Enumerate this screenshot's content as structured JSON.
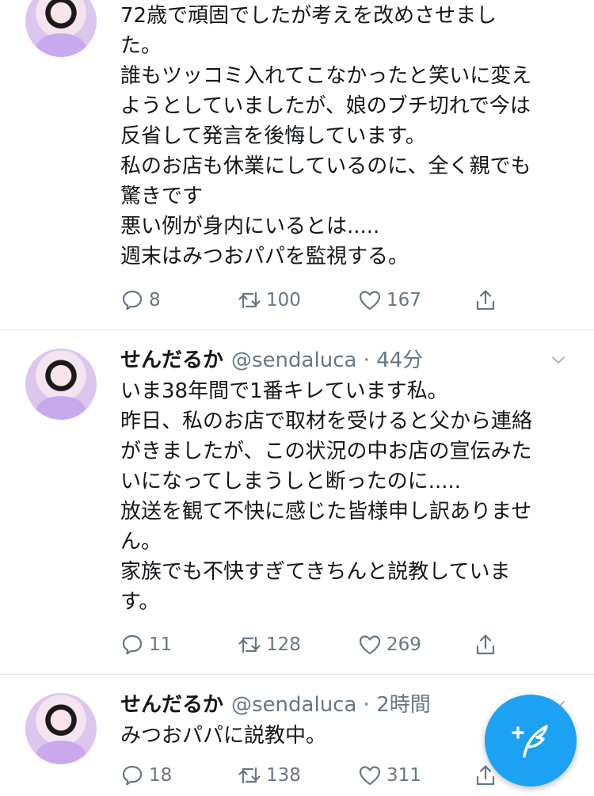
{
  "tweets": [
    {
      "name": "",
      "handle": "",
      "lines": [
        "72歳で頑固でしたが考えを改めさせまし",
        "た。",
        "誰もツッコミ入れてこなかったと笑いに変え",
        "ようとしていましたが、娘のブチ切れで今は",
        "反省して発言を後悔しています。",
        "私のお店も休業にしているのに、全く親でも",
        "驚きです",
        "悪い例が身内にいるとは.....",
        "週末はみつおパパを監視する。"
      ],
      "replies": "8",
      "retweets": "100",
      "likes": "167"
    },
    {
      "name": "せんだるか",
      "handle": "@sendaluca · 44分",
      "lines": [
        "いま38年間で1番キレています私。",
        "昨日、私のお店で取材を受けると父から連絡",
        "がきましたが、この状況の中お店の宣伝みた",
        "いになってしまうしと断ったのに.....",
        "放送を観て不快に感じた皆様申し訳ありませ",
        "ん。",
        "家族でも不快すぎてきちんと説教していま",
        "す。"
      ],
      "replies": "11",
      "retweets": "128",
      "likes": "269"
    },
    {
      "name": "せんだるか",
      "handle": "@sendaluca · 2時間",
      "lines": [
        "みつおパパに説教中。"
      ],
      "replies": "18",
      "retweets": "138",
      "likes": "311"
    }
  ],
  "icons": {
    "reply": "speech-bubble",
    "retweet": "retweet-arrows",
    "like": "heart-outline",
    "share": "share-arrow",
    "more": "chevron-down",
    "compose": "feather-plus"
  },
  "colors": {
    "text": "#14171a",
    "secondary": "#657786",
    "divider": "#e1e8ed",
    "accent": "#1da1f2"
  }
}
